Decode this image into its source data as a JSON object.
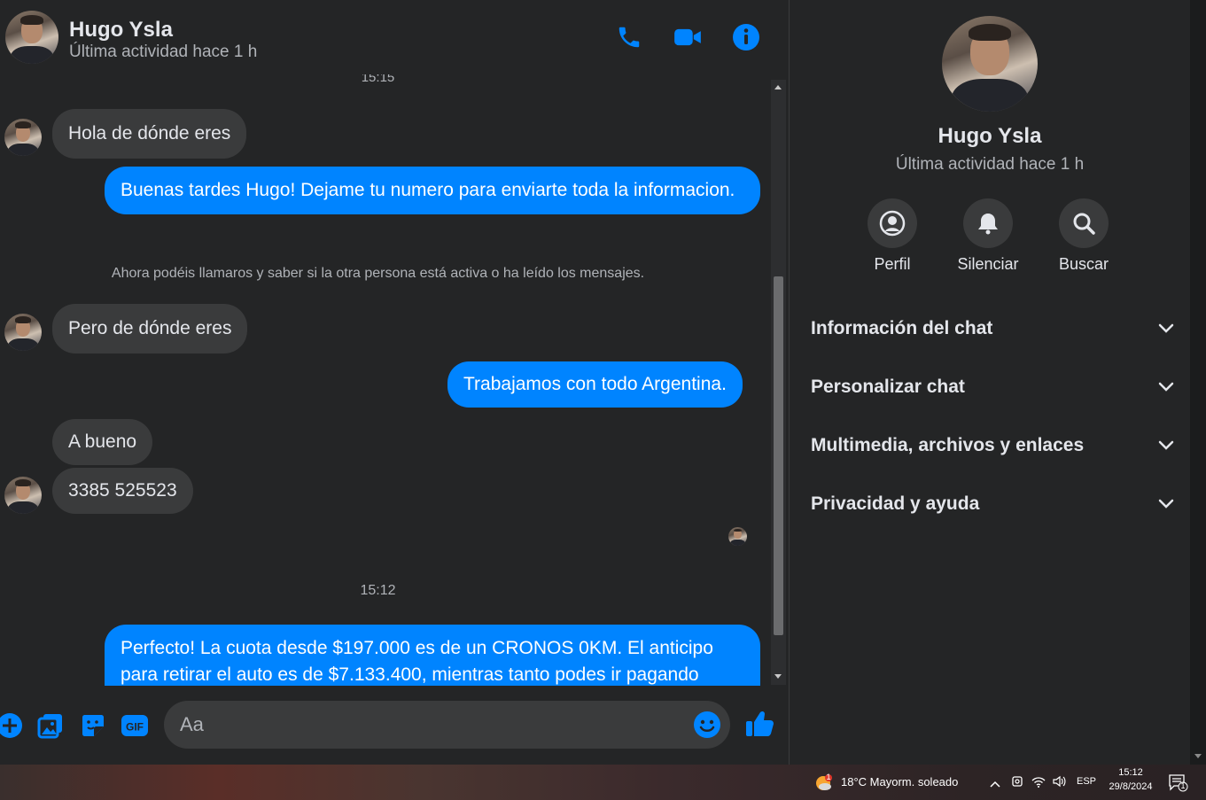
{
  "header": {
    "name": "Hugo Ysla",
    "status": "Última actividad hace 1 h"
  },
  "messages": {
    "top_timestamp": "15:15",
    "m1": "Hola de dónde eres",
    "m2": "Buenas tardes Hugo! Dejame tu numero para enviarte toda la informacion.",
    "system_notice": "Ahora podéis llamaros y saber si la otra persona está activa o ha leído los mensajes.",
    "m3": "Pero de dónde eres",
    "m4": "Trabajamos con todo Argentina.",
    "m5": "A bueno",
    "m6": "3385 525523",
    "timestamp2": "15:12",
    "m7": "Perfecto! La cuota desde $197.000 es de un CRONOS 0KM. El anticipo para retirar el auto es de $7.133.400, mientras tanto podes ir pagando"
  },
  "composer": {
    "placeholder": "Aa"
  },
  "panel": {
    "name": "Hugo Ysla",
    "status": "Última actividad hace 1 h",
    "actions": [
      "Perfil",
      "Silenciar",
      "Buscar"
    ],
    "sections": [
      "Información del chat",
      "Personalizar chat",
      "Multimedia, archivos y enlaces",
      "Privacidad y ayuda"
    ]
  },
  "taskbar": {
    "weather": "18°C  Mayorm. soleado",
    "weather_badge": "1",
    "language": "ESP",
    "time": "15:12",
    "date": "29/8/2024",
    "notif_count": "1"
  },
  "colors": {
    "accent": "#0084ff",
    "background": "#242526",
    "incoming_bubble": "#3a3b3c"
  }
}
